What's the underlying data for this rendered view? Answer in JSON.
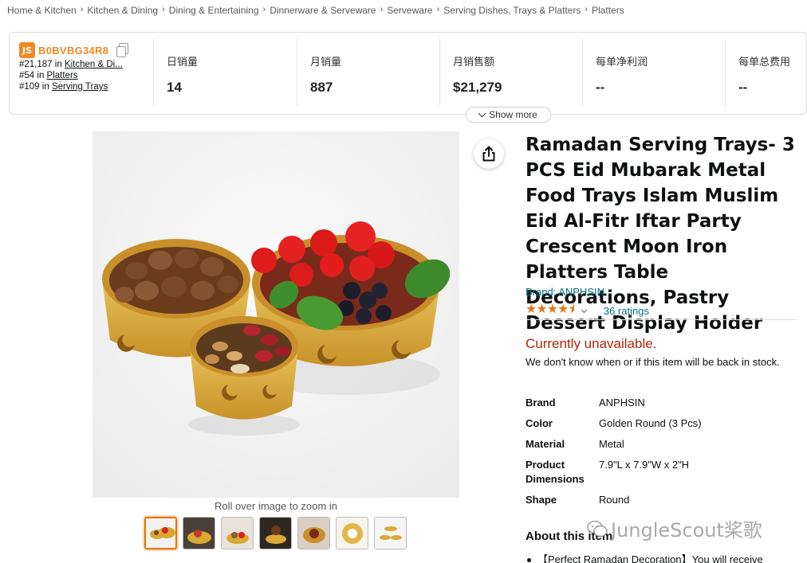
{
  "breadcrumb": [
    "Home & Kitchen",
    "Kitchen & Dining",
    "Dining & Entertaining",
    "Dinnerware & Serveware",
    "Serveware",
    "Serving Dishes, Trays & Platters",
    "Platters"
  ],
  "breadcrumb_sep": "›",
  "jsbar": {
    "logo": "JS",
    "asin": "B0BVBG34R8",
    "ranks": [
      {
        "rank": "#21,187",
        "in": "in",
        "category": "Kitchen & Di..."
      },
      {
        "rank": "#54",
        "in": "in",
        "category": "Platters"
      },
      {
        "rank": "#109",
        "in": "in",
        "category": "Serving Trays"
      }
    ],
    "metrics": [
      {
        "label": "日销量",
        "value": "14"
      },
      {
        "label": "月销量",
        "value": "887"
      },
      {
        "label": "月销售额",
        "value": "$21,279"
      },
      {
        "label": "每单净利润",
        "value": "--"
      },
      {
        "label": "每单总费用",
        "value": "--"
      }
    ],
    "show_more": "Show more"
  },
  "image": {
    "zoom_note": "Roll over image to zoom in",
    "thumbnail_count": 7
  },
  "product": {
    "title": "Ramadan Serving Trays- 3 PCS Eid Mubarak Metal Food Trays Islam Muslim Eid Al-Fitr Iftar Party Crescent Moon Iron Platters Table Decorations, Pastry Dessert Display Holder",
    "brand_link": "Brand: ANPHSIN",
    "stars": "★★★★⯨",
    "rating_value": 4.5,
    "ratings": "36 ratings",
    "availability": "Currently unavailable.",
    "availability_note": "We don't know when or if this item will be back in stock.",
    "specs": [
      {
        "key": "Brand",
        "value": "ANPHSIN"
      },
      {
        "key": "Color",
        "value": "Golden Round (3 Pcs)"
      },
      {
        "key": "Material",
        "value": "Metal"
      },
      {
        "key": "Product Dimensions",
        "value": "7.9\"L x 7.9\"W x 2\"H"
      },
      {
        "key": "Shape",
        "value": "Round"
      }
    ],
    "about_title": "About this item",
    "bullet_1": "【Perfect Ramadan Decoration】You will receive"
  },
  "watermark": "JungleScout桨歌",
  "colors": {
    "accent_orange": "#f08a24",
    "link": "#007185",
    "unavailable": "#b12704",
    "star": "#de7921",
    "tray_gold": "#d9a935"
  }
}
